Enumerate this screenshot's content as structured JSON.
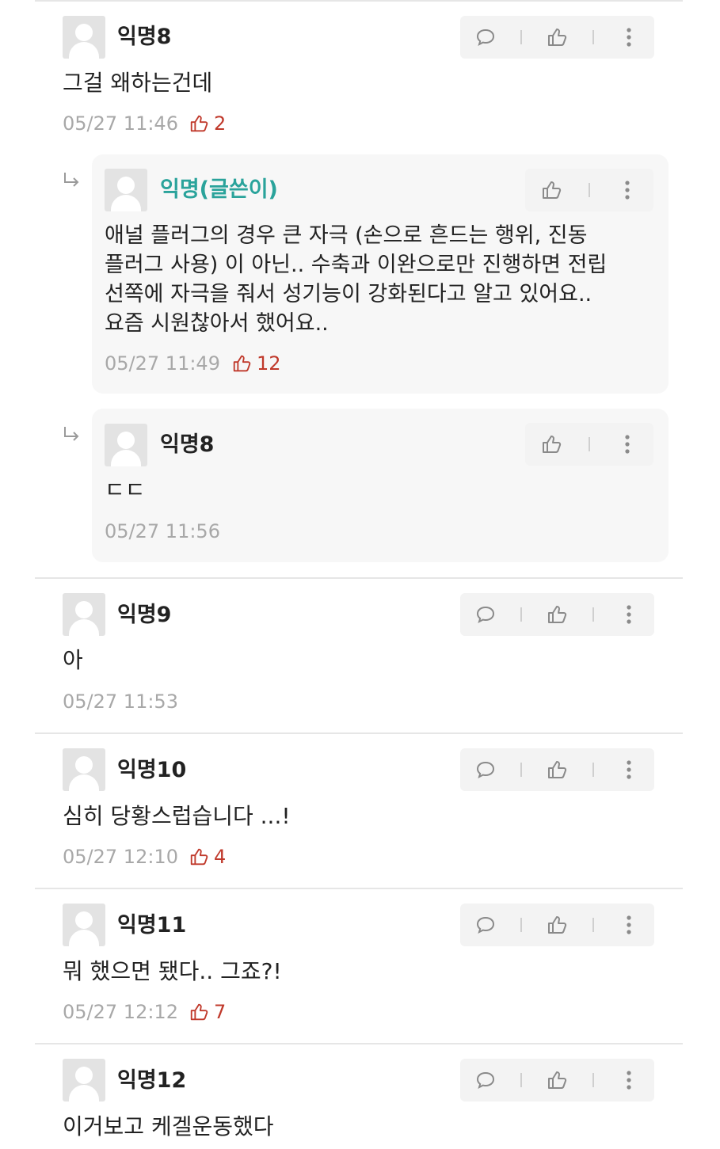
{
  "comments": [
    {
      "nick": "익명8",
      "text": "그걸 왜하는건데",
      "date": "05/27 11:46",
      "likes": "2"
    },
    {
      "nick": "익명(글쓴이)",
      "text": [
        "애널 플러그의 경우 큰 자극 (손으로 흔드는 행위, 진동",
        "플러그 사용) 이 아닌.. 수축과 이완으로만 진행하면 전립",
        "선쪽에 자극을 줘서 성기능이 강화된다고 알고 있어요..",
        "요즘 시원찮아서 했어요.."
      ],
      "date": "05/27 11:49",
      "likes": "12"
    },
    {
      "nick": "익명8",
      "text": "ㄷㄷ",
      "date": "05/27 11:56"
    },
    {
      "nick": "익명9",
      "text": "아",
      "date": "05/27 11:53"
    },
    {
      "nick": "익명10",
      "text": "심히 당황스럽습니다 ...!",
      "date": "05/27 12:10",
      "likes": "4"
    },
    {
      "nick": "익명11",
      "text": "뭐 했으면 됐다.. 그죠?!",
      "date": "05/27 12:12",
      "likes": "7"
    },
    {
      "nick": "익명12",
      "text": "이거보고 케겔운동했다"
    }
  ],
  "icons": {
    "comment": "speech-bubble-icon",
    "like": "thumbs-up-icon",
    "more": "more-vertical-icon",
    "reply": "reply-arrow-icon"
  },
  "colors": {
    "writer": "#2aa39b",
    "likes": "#c0392b",
    "meta": "#a8a8a8"
  }
}
